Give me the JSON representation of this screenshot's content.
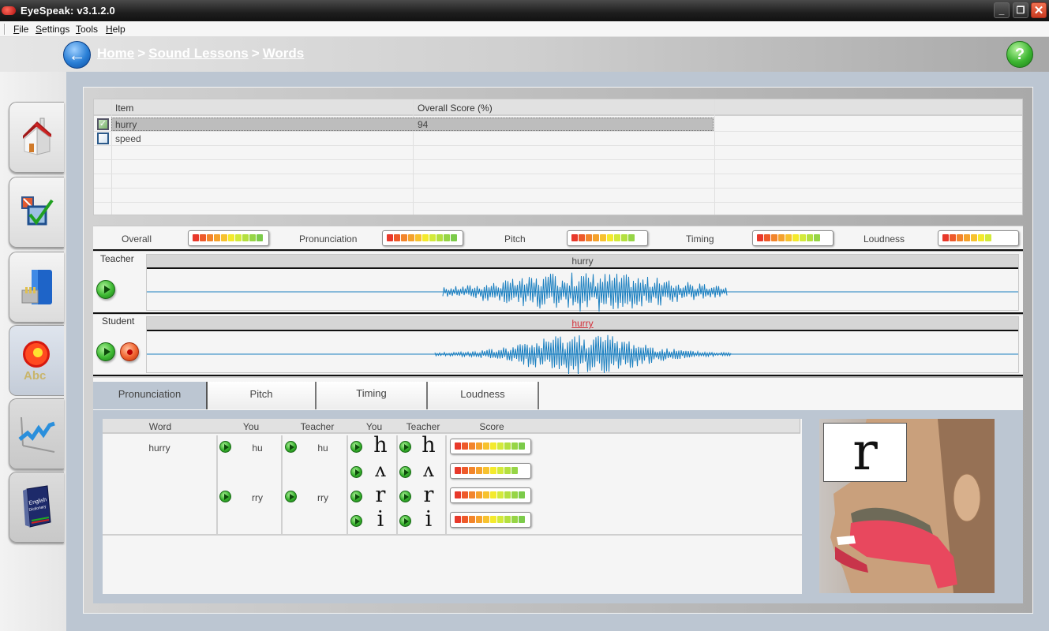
{
  "window": {
    "title": "EyeSpeak:  v3.1.2.0",
    "controls": {
      "minimize": "_",
      "maximize": "❐",
      "close": "✕"
    }
  },
  "menu": [
    {
      "label": "File",
      "mnemonic": "F",
      "rest": "ile"
    },
    {
      "label": "Settings",
      "mnemonic": "S",
      "rest": "ettings"
    },
    {
      "label": "Tools",
      "mnemonic": "T",
      "rest": "ools"
    },
    {
      "label": "Help",
      "mnemonic": "H",
      "rest": "elp"
    }
  ],
  "header": {
    "back_icon": "←",
    "help_icon": "?",
    "breadcrumb": [
      "Home",
      "Sound Lessons",
      "Words"
    ],
    "separator": ">"
  },
  "sidebar": {
    "items": [
      {
        "name": "home",
        "icon": "house-icon"
      },
      {
        "name": "tests",
        "icon": "checkbox-icon"
      },
      {
        "name": "files",
        "icon": "file-cabinet-icon"
      },
      {
        "name": "sound-lessons",
        "icon": "sound-abc-icon",
        "active": true
      },
      {
        "name": "progress",
        "icon": "line-chart-icon"
      },
      {
        "name": "dictionary",
        "icon": "dictionary-book-icon",
        "text": "English Dictionary"
      }
    ]
  },
  "item_table": {
    "columns": [
      "Item",
      "Overall Score (%)"
    ],
    "rows": [
      {
        "item": "hurry",
        "score": "94",
        "checked": true,
        "selected": true
      },
      {
        "item": "speed",
        "score": "",
        "checked": false,
        "selected": false
      }
    ]
  },
  "scores": {
    "overall": {
      "label": "Overall",
      "fill": 10
    },
    "pronunciation": {
      "label": "Pronunciation",
      "fill": 10
    },
    "pitch": {
      "label": "Pitch",
      "fill": 9
    },
    "timing": {
      "label": "Timing",
      "fill": 9
    },
    "loudness": {
      "label": "Loudness",
      "fill": 7
    },
    "meter_max": 10
  },
  "teacher": {
    "label": "Teacher",
    "word": "hurry"
  },
  "student": {
    "label": "Student",
    "word": "hurry"
  },
  "tabs": [
    {
      "label": "Pronunciation",
      "active": true
    },
    {
      "label": "Pitch",
      "active": false
    },
    {
      "label": "Timing",
      "active": false
    },
    {
      "label": "Loudness",
      "active": false
    }
  ],
  "pronunciation": {
    "columns": [
      "Word",
      "You",
      "Teacher",
      "You",
      "Teacher",
      "Score"
    ],
    "word": "hurry",
    "syllables": [
      {
        "you": "hu",
        "teacher": "hu"
      },
      {
        "you": "rry",
        "teacher": "rry"
      }
    ],
    "phonemes": [
      {
        "you": "h",
        "teacher": "h",
        "fill": 10
      },
      {
        "you": "ʌ",
        "teacher": "ʌ",
        "fill": 9
      },
      {
        "you": "r",
        "teacher": "r",
        "fill": 10
      },
      {
        "you": "i",
        "teacher": "i",
        "fill": 10
      }
    ],
    "visual_letter": "r"
  },
  "colors": {
    "meter_segments": [
      "#e8392b",
      "#ee5a2a",
      "#f2852b",
      "#f5a22c",
      "#f7c22e",
      "#f4ea2c",
      "#d3ea3a",
      "#b4e03f",
      "#96d546",
      "#7ccb4a"
    ],
    "wave": "#1a7fc0",
    "student_word": "#d3303a"
  }
}
